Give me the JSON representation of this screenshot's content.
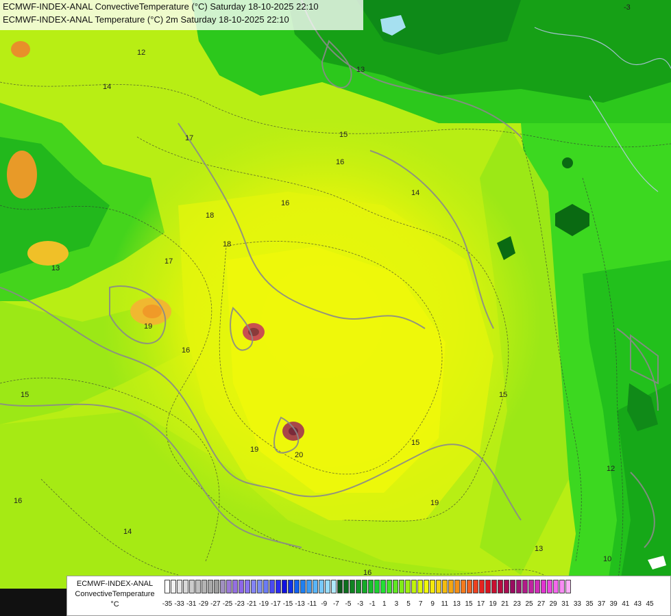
{
  "map": {
    "title_line1": "ECMWF-INDEX-ANAL ConvectiveTemperature (°C) Saturday 18-10-2025 22:10",
    "title_line2": "ECMWF-INDEX-ANAL Temperature (°C) 2m Saturday 18-10-2025 22:10",
    "colors": {
      "background_yellow": "#e8f50a",
      "background_yellow_green": "#c8f010",
      "background_light_green": "#88e818",
      "background_green": "#44d81c",
      "background_dark_green": "#16a016",
      "orange_cell": "#f0a028",
      "brown_cell": "#8a3a3a",
      "lake": "#a6e0f0",
      "contour_gray": "#8a8a8a"
    },
    "contour_labels": [
      "-3",
      "12",
      "13",
      "14",
      "15",
      "16",
      "17",
      "18",
      "19",
      "20",
      "15",
      "16",
      "19",
      "13",
      "12",
      "15",
      "14",
      "16",
      "19",
      "18",
      "17",
      "13",
      "10",
      "15",
      "16",
      "14",
      "16"
    ]
  },
  "legend": {
    "title_line1": "ECMWF-INDEX-ANAL",
    "title_line2": "ConvectiveTemperature",
    "unit": "°C",
    "colors": [
      "#ffffff",
      "#f0f0f0",
      "#e4e4e4",
      "#d8d8d8",
      "#cccccc",
      "#c0c0c0",
      "#b4b4b4",
      "#a8a8a8",
      "#9c9c9c",
      "#a090c0",
      "#9c7ad8",
      "#9470e0",
      "#8c66e8",
      "#8a74f0",
      "#8484f4",
      "#7c8cf4",
      "#6c7cf4",
      "#4a4af0",
      "#2a2af0",
      "#1010e0",
      "#1030e8",
      "#1060f0",
      "#2080f0",
      "#3c9cf4",
      "#58b4f8",
      "#78c8fa",
      "#98dcfc",
      "#b0e8fc",
      "#0e5a1c",
      "#0e6e1e",
      "#108222",
      "#129626",
      "#14aa28",
      "#18be2c",
      "#1cd230",
      "#22e034",
      "#40e428",
      "#60e820",
      "#80ec18",
      "#a0f012",
      "#c0f40c",
      "#dcf80a",
      "#f0f80a",
      "#f4e80a",
      "#f4d20c",
      "#f4bc10",
      "#f4a614",
      "#f49018",
      "#f47a1c",
      "#f06020",
      "#ec4020",
      "#e42420",
      "#d81420",
      "#c81030",
      "#b80c40",
      "#a80c50",
      "#980c60",
      "#a01470",
      "#b01c88",
      "#c024a0",
      "#d02cb8",
      "#e034d0",
      "#ec48e0",
      "#f468ec",
      "#f88cf4",
      "#fcb0f8"
    ],
    "ticks": [
      "-35",
      "-33",
      "-31",
      "-29",
      "-27",
      "-25",
      "-23",
      "-21",
      "-19",
      "-17",
      "-15",
      "-13",
      "-11",
      "-9",
      "-7",
      "-5",
      "-3",
      "-1",
      "1",
      "3",
      "5",
      "7",
      "9",
      "11",
      "13",
      "15",
      "17",
      "19",
      "21",
      "23",
      "25",
      "27",
      "29",
      "31",
      "33",
      "35",
      "37",
      "39",
      "41",
      "43",
      "45"
    ]
  }
}
